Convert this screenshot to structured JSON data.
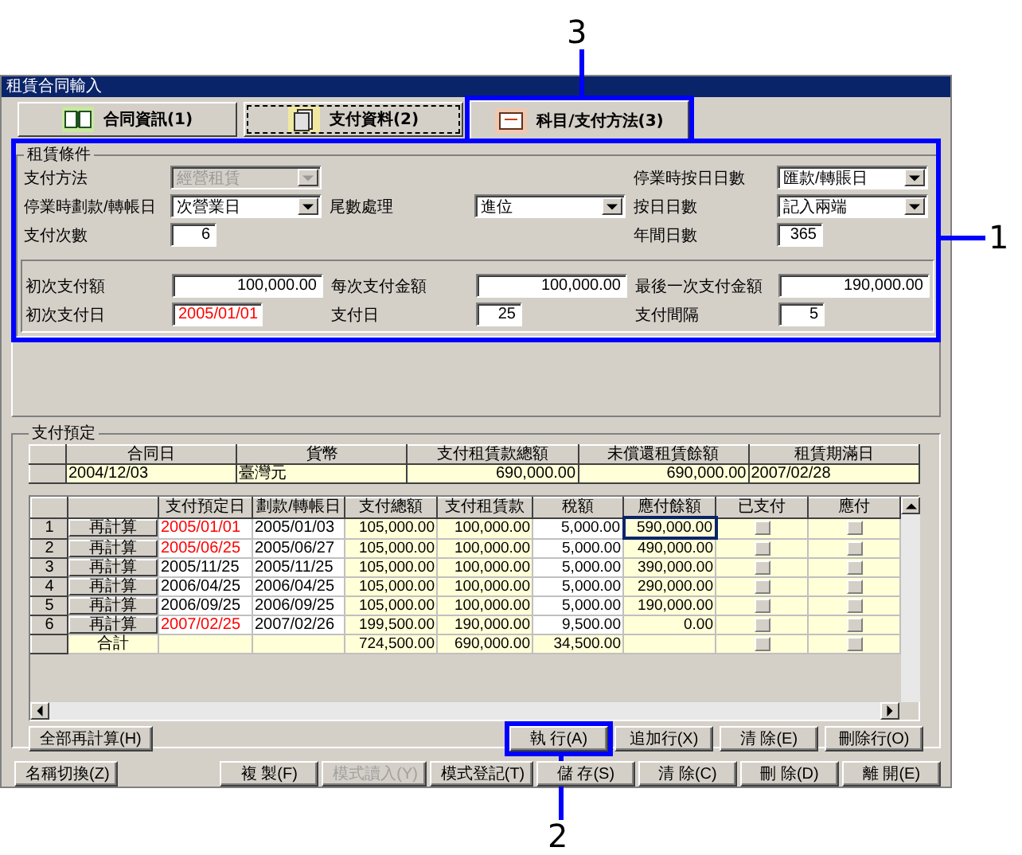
{
  "window": {
    "title": "租賃合同輸入"
  },
  "tabs": [
    {
      "label": "合同資訊(1)",
      "selected": false,
      "focused": false
    },
    {
      "label": "支付資料(2)",
      "selected": false,
      "focused": true
    },
    {
      "label": "科目/支付方法(3)",
      "selected": true,
      "focused": false,
      "callout": "3"
    }
  ],
  "conditions": {
    "title": "租賃條件",
    "callout": "1",
    "rows": [
      [
        {
          "label": "支付方法",
          "kind": "select",
          "value": "經營租賃",
          "disabled": true,
          "flagged": false
        },
        {
          "kind": "blank"
        },
        {
          "label": "停業時按日日數",
          "kind": "select",
          "value": "匯款/轉賬日",
          "disabled": false,
          "flagged": false
        }
      ],
      [
        {
          "label": "停業時劃款/轉帳日",
          "kind": "select",
          "value": "次營業日",
          "disabled": false,
          "flagged": false
        },
        {
          "label": "尾數處理",
          "kind": "select",
          "value": "進位",
          "disabled": false,
          "flagged": false
        },
        {
          "label": "按日日數",
          "kind": "select",
          "value": "記入兩端",
          "disabled": false,
          "flagged": false
        }
      ],
      [
        {
          "label": "支付次數",
          "kind": "count",
          "value": "6",
          "disabled": false,
          "flagged": false
        },
        {
          "kind": "blank"
        },
        {
          "label": "年間日數",
          "kind": "count",
          "value": "365",
          "disabled": false,
          "flagged": false
        }
      ]
    ],
    "payment_rows": [
      [
        {
          "label": "初次支付額",
          "kind": "amount",
          "value": "100,000.00",
          "disabled": false,
          "flagged": false
        },
        {
          "label": "每次支付金額",
          "kind": "amount",
          "value": "100,000.00",
          "disabled": false,
          "flagged": false
        },
        {
          "label": "最後一次支付金額",
          "kind": "amount",
          "value": "190,000.00",
          "disabled": false,
          "flagged": false
        }
      ],
      [
        {
          "label": "初次支付日",
          "kind": "date",
          "value": "2005/01/01",
          "disabled": false,
          "flagged": true
        },
        {
          "label": "支付日",
          "kind": "count",
          "value": "25",
          "disabled": false,
          "flagged": false
        },
        {
          "label": "支付間隔",
          "kind": "count",
          "value": "5",
          "disabled": false,
          "flagged": false
        }
      ]
    ]
  },
  "schedule": {
    "title": "支付預定",
    "summary": {
      "columns": [
        "合同日",
        "貨幣",
        "支付租賃款總額",
        "未償還租賃餘額",
        "租賃期滿日"
      ],
      "values": [
        "2004/12/03",
        "臺灣元",
        "690,000.00",
        "690,000.00",
        "2007/02/28"
      ]
    },
    "columns": [
      "支付預定日",
      "劃款/轉帳日",
      "支付總額",
      "支付租賃款",
      "稅額",
      "應付餘額",
      "已支付",
      "應付"
    ],
    "rows": [
      {
        "index": "1",
        "action": "再計算",
        "due_date": "2005/01/01",
        "flagged": true,
        "transfer_date": "2005/01/03",
        "total": "105,000.00",
        "lease": "100,000.00",
        "tax": "5,000.00",
        "balance": "590,000.00",
        "paid": false,
        "payable": false,
        "selected": true
      },
      {
        "index": "2",
        "action": "再計算",
        "due_date": "2005/06/25",
        "flagged": true,
        "transfer_date": "2005/06/27",
        "total": "105,000.00",
        "lease": "100,000.00",
        "tax": "5,000.00",
        "balance": "490,000.00",
        "paid": false,
        "payable": false,
        "selected": false
      },
      {
        "index": "3",
        "action": "再計算",
        "due_date": "2005/11/25",
        "flagged": false,
        "transfer_date": "2005/11/25",
        "total": "105,000.00",
        "lease": "100,000.00",
        "tax": "5,000.00",
        "balance": "390,000.00",
        "paid": false,
        "payable": false,
        "selected": false
      },
      {
        "index": "4",
        "action": "再計算",
        "due_date": "2006/04/25",
        "flagged": false,
        "transfer_date": "2006/04/25",
        "total": "105,000.00",
        "lease": "100,000.00",
        "tax": "5,000.00",
        "balance": "290,000.00",
        "paid": false,
        "payable": false,
        "selected": false
      },
      {
        "index": "5",
        "action": "再計算",
        "due_date": "2006/09/25",
        "flagged": false,
        "transfer_date": "2006/09/25",
        "total": "105,000.00",
        "lease": "100,000.00",
        "tax": "5,000.00",
        "balance": "190,000.00",
        "paid": false,
        "payable": false,
        "selected": false
      },
      {
        "index": "6",
        "action": "再計算",
        "due_date": "2007/02/25",
        "flagged": true,
        "transfer_date": "2007/02/26",
        "total": "199,500.00",
        "lease": "190,000.00",
        "tax": "9,500.00",
        "balance": "0.00",
        "paid": false,
        "payable": false,
        "selected": false
      }
    ],
    "totals": {
      "label": "合計",
      "total": "724,500.00",
      "lease": "690,000.00",
      "tax": "34,500.00",
      "paid": false,
      "payable": false
    },
    "left_buttons": [
      {
        "label": "全部再計算(H)",
        "disabled": false
      }
    ],
    "right_buttons": [
      {
        "label": "執 行(A)",
        "disabled": false,
        "callout": "2"
      },
      {
        "label": "追加行(X)",
        "disabled": false
      },
      {
        "label": "清 除(E)",
        "disabled": false
      },
      {
        "label": "刪除行(O)",
        "disabled": false
      }
    ]
  },
  "footer": {
    "left_buttons": [
      {
        "label": "名稱切換(Z)",
        "disabled": false
      }
    ],
    "right_buttons": [
      {
        "label": "複 製(F)",
        "disabled": false
      },
      {
        "label": "模式讀入(Y)",
        "disabled": true
      },
      {
        "label": "模式登記(T)",
        "disabled": false
      },
      {
        "label": "儲 存(S)",
        "disabled": false
      },
      {
        "label": "清 除(C)",
        "disabled": false
      },
      {
        "label": "刪 除(D)",
        "disabled": false
      },
      {
        "label": "離 開(E)",
        "disabled": false
      }
    ]
  }
}
